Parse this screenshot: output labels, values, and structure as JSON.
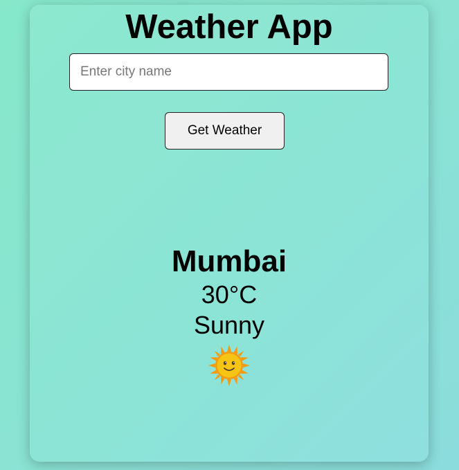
{
  "app": {
    "title": "Weather App"
  },
  "search": {
    "placeholder": "Enter city name",
    "value": ""
  },
  "actions": {
    "get_weather_label": "Get Weather"
  },
  "weather": {
    "city": "Mumbai",
    "temperature": "30°C",
    "condition": "Sunny",
    "icon": "sun-icon"
  },
  "colors": {
    "sun_body": "#f6b60e",
    "sun_rays": "#f39c12",
    "background_start": "#86e8c9",
    "background_end": "#8bdcdc"
  }
}
